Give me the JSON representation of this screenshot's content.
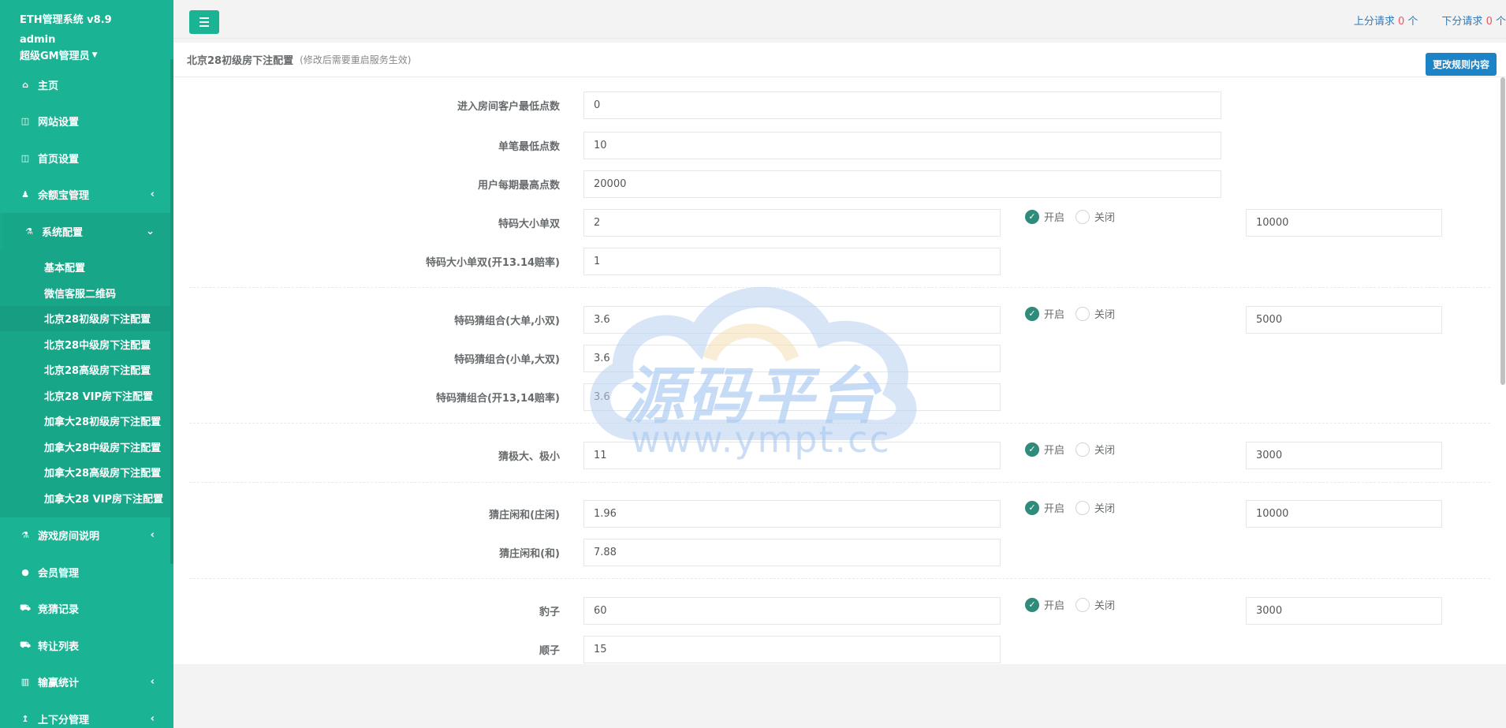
{
  "brand": {
    "title": "ETH管理系统 v8.9",
    "user": "admin",
    "role": "超级GM管理员"
  },
  "nav": [
    {
      "label": "主页",
      "icon": "home-icon"
    },
    {
      "label": "网站设置",
      "icon": "columns-icon"
    },
    {
      "label": "首页设置",
      "icon": "columns-icon"
    },
    {
      "label": "余额宝管理",
      "icon": "wallet-icon",
      "arrow": "‹"
    },
    {
      "label": "系统配置",
      "icon": "flask-icon",
      "arrow": "⌄"
    },
    {
      "label": "游戏房间说明",
      "icon": "flask-icon",
      "arrow": "‹"
    },
    {
      "label": "会员管理",
      "icon": "user-icon"
    },
    {
      "label": "竞猜记录",
      "icon": "car-icon"
    },
    {
      "label": "转让列表",
      "icon": "car-icon"
    },
    {
      "label": "输赢统计",
      "icon": "bar-chart-icon",
      "arrow": "‹"
    },
    {
      "label": "上下分管理",
      "icon": "level-up-icon",
      "arrow": "‹"
    }
  ],
  "subnav": [
    "基本配置",
    "微信客服二维码",
    "北京28初级房下注配置",
    "北京28中级房下注配置",
    "北京28高级房下注配置",
    "北京28 VIP房下注配置",
    "加拿大28初级房下注配置",
    "加拿大28中级房下注配置",
    "加拿大28高级房下注配置",
    "加拿大28 VIP房下注配置"
  ],
  "topbar": {
    "up_label": "上分请求",
    "up_count": "0",
    "down_label": "下分请求",
    "down_count": "0",
    "unit": "个"
  },
  "panel": {
    "title": "北京28初级房下注配置",
    "hint": "(修改后需要重启服务生效)",
    "edit_button": "更改规则内容"
  },
  "radio": {
    "on": "开启",
    "off": "关闭"
  },
  "form": {
    "min_points": {
      "label": "进入房间客户最低点数",
      "value": "0"
    },
    "single_min": {
      "label": "单笔最低点数",
      "value": "10"
    },
    "period_max": {
      "label": "用户每期最高点数",
      "value": "20000"
    },
    "tema_dxds": {
      "label": "特码大小单双",
      "value": "2",
      "limit": "10000"
    },
    "tema_dxds_1314": {
      "label": "特码大小单双(开13.14赔率)",
      "value": "1"
    },
    "combo_big": {
      "label": "特码猜组合(大单,小双)",
      "value": "3.6",
      "limit": "5000"
    },
    "combo_small": {
      "label": "特码猜组合(小单,大双)",
      "value": "3.6"
    },
    "combo_1314": {
      "label": "特码猜组合(开13,14赔率)",
      "value": "3.6"
    },
    "extreme": {
      "label": "猜极大、极小",
      "value": "11",
      "limit": "3000"
    },
    "banker_idle": {
      "label": "猜庄闲和(庄闲)",
      "value": "1.96",
      "limit": "10000"
    },
    "banker_tie": {
      "label": "猜庄闲和(和)",
      "value": "7.88"
    },
    "leopard": {
      "label": "豹子",
      "value": "60",
      "limit": "3000"
    },
    "straight": {
      "label": "顺子",
      "value": "15"
    }
  },
  "watermark": {
    "text": "源码平台",
    "url": "www.ympt.cc"
  }
}
